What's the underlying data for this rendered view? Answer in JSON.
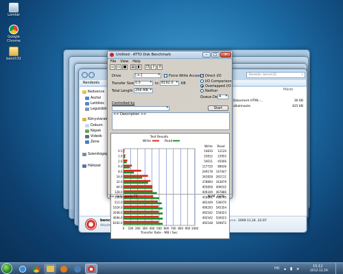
{
  "desktop": {
    "icons": [
      {
        "label": "Lomtár",
        "icon": "recycle-bin-icon"
      },
      {
        "label": "Google Chrome",
        "icon": "chrome-icon"
      },
      {
        "label": "bench32",
        "icon": "folder-icon"
      }
    ]
  },
  "explorer": {
    "search_placeholder": "Keresés: bench32",
    "organize_label": "Rendezés",
    "nav": {
      "favorites": "Kedvence",
      "desktop": "Asztal",
      "downloads": "Letöltés",
      "recent": "Legutóbbi",
      "libraries": "Könyvtárak",
      "docs": "Dokum",
      "pictures": "Képek",
      "videos": "Videók",
      "music": "Zene",
      "computer": "Számítógép",
      "network": "Hálózat"
    },
    "size_header": "Méret",
    "files": [
      {
        "name": "Dokument HTML-...",
        "size": "36 KB"
      },
      {
        "name": "alkalmazás",
        "size": "425 KB"
      }
    ],
    "details": {
      "name": "bench32",
      "type": "Alkalmazás",
      "modified_label": "Módosítás dátuma:",
      "modified": "2012.12.29. 15:08",
      "created_label": "Létrehozás dátuma:",
      "created": "2009.11.24. 22:07",
      "size_label": "Méret:",
      "size": "422 KB"
    }
  },
  "atto": {
    "title": "Untitled - ATTO Disk Benchmark",
    "menu": [
      "File",
      "View",
      "Help"
    ],
    "drive_label": "Drive",
    "drive_value": "[-c-]",
    "force_write_label": "Force Write Access",
    "direct_io_label": "Direct I/O",
    "transfer_size_label": "Transfer Size",
    "transfer_from": "0.5",
    "transfer_to_label": "to",
    "transfer_to": "8192.0",
    "transfer_unit": "KB",
    "io_comparison_label": "I/O Comparison",
    "overlapped_io_label": "Overlapped I/O",
    "total_length_label": "Total Length",
    "total_length": "256 MB",
    "neither_label": "Neither",
    "queue_depth_label": "Queue Depth",
    "queue_depth": "4",
    "controlled_by_label": "Controlled by",
    "controlled_by_value": "",
    "start_label": "Start",
    "description": "<< Description >>",
    "status_left": "For Help, press F1",
    "status_num": "NUM",
    "status_scrl": "SCRL"
  },
  "chart_data": {
    "type": "bar",
    "title": "Test Results",
    "legend": [
      "Write",
      "Read"
    ],
    "colors": {
      "write": "#d62b1e",
      "read": "#1f8f2a"
    },
    "xlabel": "Transfer Rate - MB / Sec",
    "xlim": [
      0,
      1000
    ],
    "xticks": [
      0,
      100,
      200,
      300,
      400,
      500,
      600,
      700,
      800,
      900,
      1000
    ],
    "write_header": "Write",
    "read_header": "Read",
    "categories": [
      "0.5",
      "1.0",
      "2.0",
      "4.0",
      "8.0",
      "16.0",
      "32.0",
      "64.0",
      "128.0",
      "256.0",
      "512.0",
      "1024.0",
      "2048.0",
      "4096.0",
      "8192.0"
    ],
    "series": [
      {
        "name": "Write",
        "values": [
          14.5,
          25.8,
          54.0,
          117.7,
          249.2,
          342.8,
          378.9,
          405.9,
          409.3,
          416.9,
          481.4,
          490.3,
          492.5,
          492.5,
          492.5
        ]
      },
      {
        "name": "Read",
        "values": [
          12.1,
          23.4,
          45.0,
          89.6,
          147.4,
          262.1,
          343.9,
          406.0,
          467.9,
          498.7,
          536.1,
          545.3,
          550.0,
          550.0,
          549.9
        ]
      }
    ],
    "write_labels": [
      "14810",
      "25812",
      "54011",
      "117720",
      "249178",
      "342828",
      "378894",
      "405858",
      "409349",
      "416891",
      "481449",
      "490293",
      "492542",
      "492542",
      "492548"
    ],
    "read_labels": [
      "12120",
      "23955",
      "45006",
      "89636",
      "147447",
      "262111",
      "343879",
      "406032",
      "467886",
      "498743",
      "536070",
      "545354",
      "550023",
      "550023",
      "549872"
    ]
  },
  "taskbar": {
    "clock_time": "15:12",
    "clock_date": "2012.12.29.",
    "language": "HU"
  }
}
